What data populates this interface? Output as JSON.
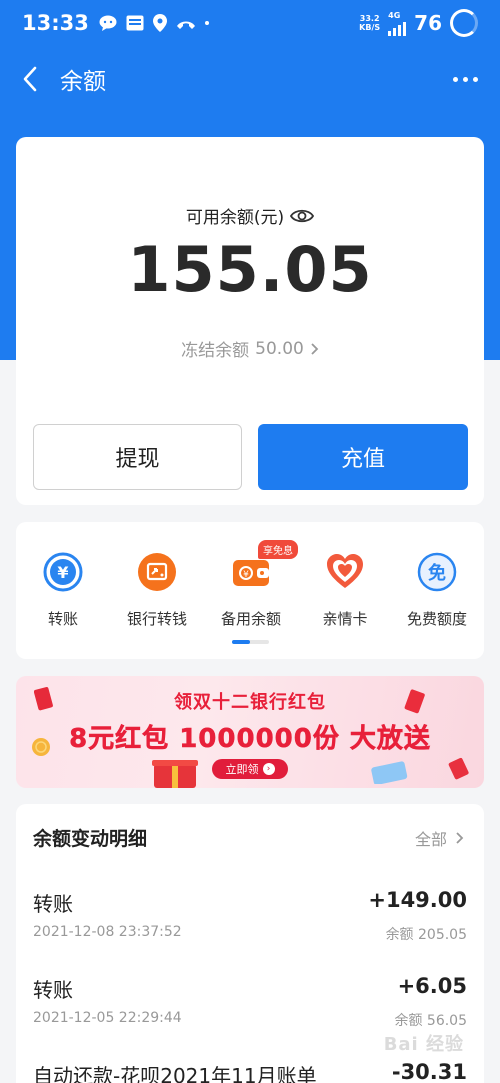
{
  "status_bar": {
    "time": "13:33",
    "net_speed_value": "33.2",
    "net_speed_unit": "KB/S",
    "network": "4G",
    "battery": "76"
  },
  "nav": {
    "title": "余额"
  },
  "balance": {
    "label": "可用余额(元)",
    "amount": "155.05",
    "frozen_label": "冻结余额",
    "frozen_amount": "50.00",
    "withdraw_label": "提现",
    "topup_label": "充值"
  },
  "services": {
    "items": [
      {
        "label": "转账",
        "icon": "transfer-icon"
      },
      {
        "label": "银行转钱",
        "icon": "bank-transfer-icon"
      },
      {
        "label": "备用余额",
        "icon": "wallet-icon",
        "badge": "享免息"
      },
      {
        "label": "亲情卡",
        "icon": "family-card-icon"
      },
      {
        "label": "免费额度",
        "icon": "free-quota-icon"
      }
    ],
    "free_icon_glyph": "免",
    "page_indicator": {
      "current": 1,
      "total": 2
    }
  },
  "promo": {
    "headline": "领双十二银行红包",
    "main_text": "8元红包 1000000份 大放送",
    "button": "立即领"
  },
  "transactions": {
    "title": "余额变动明细",
    "all_label": "全部",
    "rows": [
      {
        "title": "转账",
        "amount": "+149.00",
        "time": "2021-12-08 23:37:52",
        "balance": "余额 205.05"
      },
      {
        "title": "转账",
        "amount": "+6.05",
        "time": "2021-12-05 22:29:44",
        "balance": "余额 56.05"
      },
      {
        "title": "自动还款-花呗2021年11月账单",
        "amount": "-30.31",
        "time": "",
        "balance": ""
      }
    ]
  },
  "watermark": "Bai 经验",
  "colors": {
    "brand_blue": "#1e7cf0",
    "service_blue": "#2a85f0",
    "service_orange": "#f5721c",
    "promo_red": "#e8203a"
  }
}
